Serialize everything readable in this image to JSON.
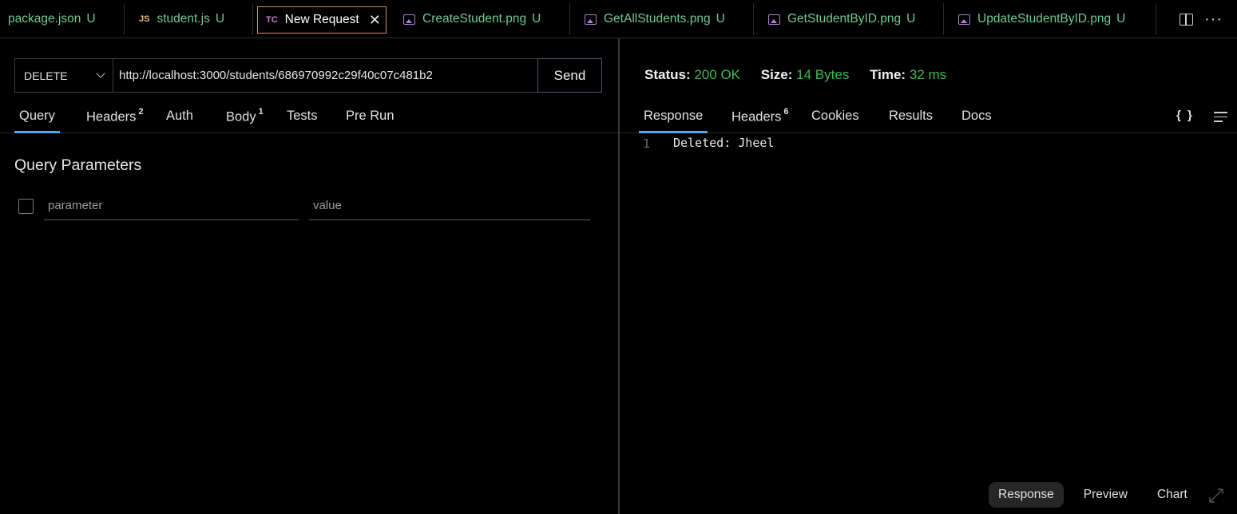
{
  "tabs": [
    {
      "icon": "json-icon",
      "label": "package.json",
      "status": "U",
      "active": false
    },
    {
      "icon": "js-icon",
      "icon_text": "JS",
      "label": "student.js",
      "status": "U",
      "active": false
    },
    {
      "icon": "thunder-client-icon",
      "icon_text": "TC",
      "label": "New Request",
      "active": true
    },
    {
      "icon": "image-file-icon",
      "label": "CreateStudent.png",
      "status": "U",
      "active": false
    },
    {
      "icon": "image-file-icon",
      "label": "GetAllStudents.png",
      "status": "U",
      "active": false
    },
    {
      "icon": "image-file-icon",
      "label": "GetStudentByID.png",
      "status": "U",
      "active": false
    },
    {
      "icon": "image-file-icon",
      "label": "UpdateStudentByID.png",
      "status": "U",
      "active": false
    }
  ],
  "tabbar_actions": {
    "split": "split-editor-icon",
    "more": "more-icon"
  },
  "request": {
    "method": "DELETE",
    "url": "http://localhost:3000/students/686970992c29f40c07c481b2",
    "send_label": "Send"
  },
  "request_tabs": [
    {
      "label": "Query",
      "badge": ""
    },
    {
      "label": "Headers",
      "badge": "2"
    },
    {
      "label": "Auth",
      "badge": ""
    },
    {
      "label": "Body",
      "badge": "1"
    },
    {
      "label": "Tests",
      "badge": ""
    },
    {
      "label": "Pre Run",
      "badge": ""
    }
  ],
  "query": {
    "title": "Query Parameters",
    "param_placeholder": "parameter",
    "value_placeholder": "value"
  },
  "response": {
    "status_label": "Status:",
    "status_value": "200 OK",
    "size_label": "Size:",
    "size_value": "14 Bytes",
    "time_label": "Time:",
    "time_value": "32 ms",
    "line_number": "1",
    "body": "Deleted: Jheel",
    "json_toggle": "{ }"
  },
  "response_tabs": [
    {
      "label": "Response",
      "badge": ""
    },
    {
      "label": "Headers",
      "badge": "6"
    },
    {
      "label": "Cookies",
      "badge": ""
    },
    {
      "label": "Results",
      "badge": ""
    },
    {
      "label": "Docs",
      "badge": ""
    }
  ],
  "bottom_tabs": [
    {
      "label": "Response",
      "active": true
    },
    {
      "label": "Preview",
      "active": false
    },
    {
      "label": "Chart",
      "active": false
    }
  ],
  "colors": {
    "accent": "#4fa8e8",
    "status_ok": "#3fb950",
    "git_untracked": "#73c991",
    "active_tab_border": "#e08c6a"
  }
}
